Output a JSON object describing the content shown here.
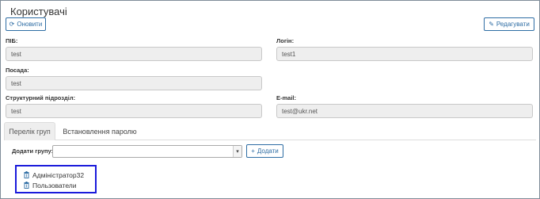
{
  "page": {
    "title": "Користувачі"
  },
  "toolbar": {
    "refresh_label": "Оновити",
    "edit_label": "Редагувати",
    "refresh_icon": "refresh-icon",
    "edit_icon": "edit-icon"
  },
  "form": {
    "pib": {
      "label": "ПІБ:",
      "value": "test"
    },
    "login": {
      "label": "Логін:",
      "value": "test1"
    },
    "position": {
      "label": "Посада:",
      "value": "test"
    },
    "department": {
      "label": "Структурний підрозділ:",
      "value": "test"
    },
    "email": {
      "label": "E-mail:",
      "value": "test@ukr.net"
    }
  },
  "tabs": [
    {
      "label": "Перелік груп",
      "active": true
    },
    {
      "label": "Встановлення паролю",
      "active": false
    }
  ],
  "add_group": {
    "label": "Додати групу:",
    "selected": "",
    "button_label": "Додати",
    "button_icon": "plus-icon"
  },
  "groups": [
    {
      "name": "Адміністратор32",
      "icon": "trash-icon"
    },
    {
      "name": "Пользователи",
      "icon": "trash-icon"
    }
  ],
  "colors": {
    "accent": "#2e6da4",
    "highlight_border": "#1a1adb",
    "field_bg": "#eeeeee"
  }
}
